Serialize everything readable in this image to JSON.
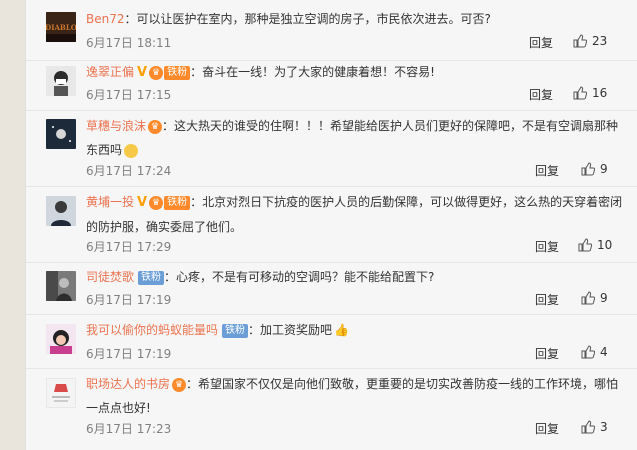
{
  "comments": [
    {
      "user": "Ben72",
      "text": "：可以让医护在室内，那种是独立空调的房子，市民依次进去。可否?",
      "date": "6月17日 18:11",
      "reply": "回复",
      "likes": "23"
    },
    {
      "user": "逸翠正偏",
      "badge": "铁粉",
      "text": "：奋斗在一线！为了大家的健康着想！不容易!",
      "date": "6月17日 17:15",
      "reply": "回复",
      "likes": "16"
    },
    {
      "user": "草穗与浪沫",
      "text": "：这大热天的谁受的住啊！！！希望能给医护人员们更好的保障吧，不是有空调扇那种东西吗",
      "date": "6月17日 17:24",
      "reply": "回复",
      "likes": "9"
    },
    {
      "user": "黄埔一投",
      "badge": "铁粉",
      "text": "：北京对烈日下抗疫的医护人员的后勤保障，可以做得更好，这么热的天穿着密闭的防护服，确实委屈了他们。",
      "date": "6月17日 17:29",
      "reply": "回复",
      "likes": "10"
    },
    {
      "user": "司徒焚歌",
      "badge": "铁粉",
      "text": "：心疼，不是有可移动的空调吗？能不能给配置下?",
      "date": "6月17日 17:19",
      "reply": "回复",
      "likes": "9"
    },
    {
      "user": "我可以偷你的蚂蚁能量吗",
      "badge": "铁粉",
      "text": "：加工资奖励吧",
      "date": "6月17日 17:19",
      "reply": "回复",
      "likes": "4"
    },
    {
      "user": "职场达人的书房",
      "text": "：希望国家不仅仅是向他们致敬，更重要的是切实改善防疫一线的工作环境，哪怕一点点也好!",
      "date": "6月17日 17:23",
      "reply": "回复",
      "likes": "3"
    }
  ],
  "icons": {
    "like": "thumbs-up-icon",
    "verified": "verified-v-icon",
    "crown": "crown-badge-icon"
  },
  "colors": {
    "username": "#eb7350",
    "verified": "#ffa000",
    "fan_badge_orange": "#ff8a2b",
    "fan_badge_blue": "#6b9ed6"
  }
}
